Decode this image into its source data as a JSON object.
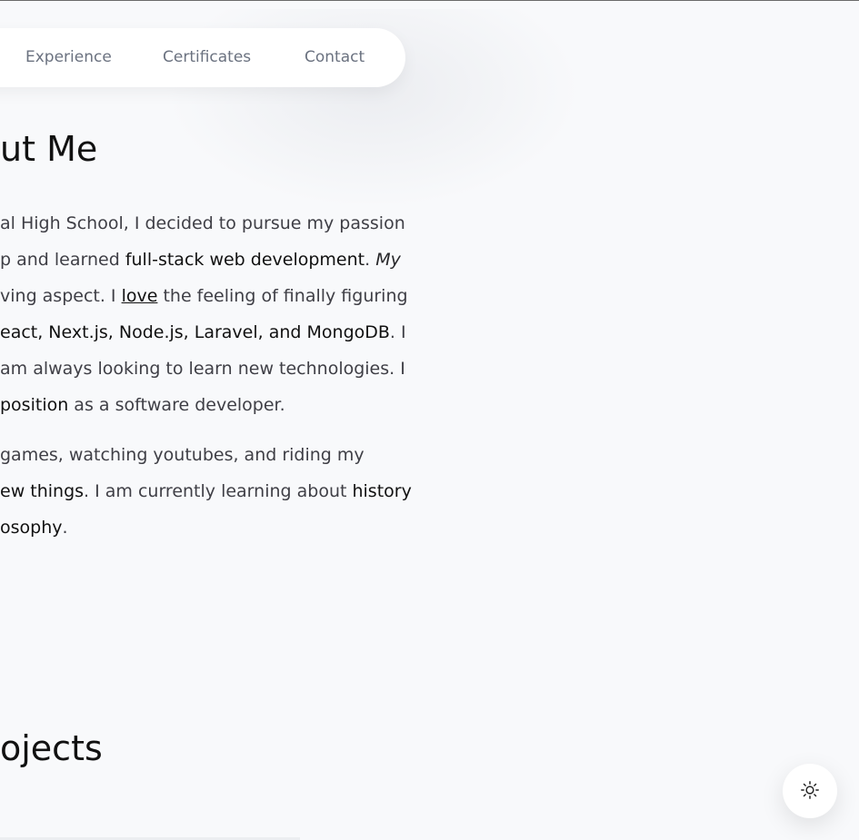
{
  "nav": {
    "items": [
      "Experience",
      "Certificates",
      "Contact"
    ]
  },
  "about": {
    "heading": "ut Me",
    "paragraph1": {
      "line1": "al High School, I decided to pursue my passion",
      "line2_pre": "p and learned ",
      "line2_bold": "full-stack web development",
      "line2_mid": ". ",
      "line2_italic": "My",
      "line3_pre": "ving aspect. I ",
      "line3_underline": "love",
      "line3_post": " the feeling of finally figuring",
      "line4_bold": "eact, Next.js, Node.js, Laravel, and MongoDB",
      "line4_post": ". I",
      "line5": "am always looking to learn new technologies. I",
      "line6_bold": " position",
      "line6_post": " as a software developer."
    },
    "paragraph2": {
      "line1": " games, watching youtubes, and riding my",
      "line2_bold": "ew things",
      "line2_mid": ". I am currently learning about ",
      "line2_bold2": "history",
      "line3_bold": "osophy",
      "line3_post": "."
    }
  },
  "projects": {
    "heading": "ojects"
  },
  "theme_toggle": {
    "icon": "sun-icon"
  }
}
